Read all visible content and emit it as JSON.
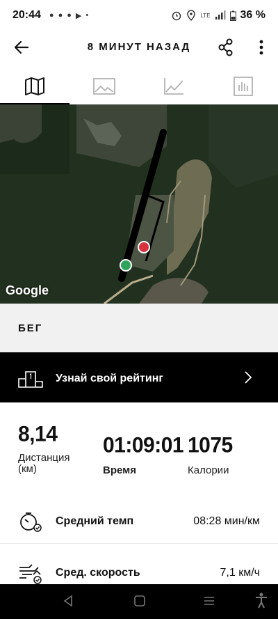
{
  "status": {
    "time": "20:44",
    "network": "LTE",
    "battery": "36 %"
  },
  "header": {
    "title": "8 МИНУТ НАЗАД"
  },
  "tabs": [
    {
      "name": "map",
      "icon": "map-icon",
      "active": true
    },
    {
      "name": "photos",
      "icon": "image-icon",
      "active": false
    },
    {
      "name": "graph",
      "icon": "line-chart-icon",
      "active": false
    },
    {
      "name": "splits",
      "icon": "bar-chart-icon",
      "active": false
    }
  ],
  "map": {
    "attribution": "Google",
    "start_color": "#2fa35a",
    "end_color": "#d8323f"
  },
  "activity": {
    "type": "БЕГ"
  },
  "rating": {
    "label": "Узнай свой рейтинг"
  },
  "stats": {
    "distance": {
      "value": "8,14",
      "label": "Дистанция",
      "unit": "(км)"
    },
    "time": {
      "value": "01:09:01",
      "label": "Время"
    },
    "calories": {
      "value": "1075",
      "label": "Калории"
    }
  },
  "details": {
    "pace": {
      "label": "Средний темп",
      "value": "08:28 мин/км"
    },
    "speed": {
      "label": "Сред. скорость",
      "value": "7,1 км/ч"
    }
  }
}
